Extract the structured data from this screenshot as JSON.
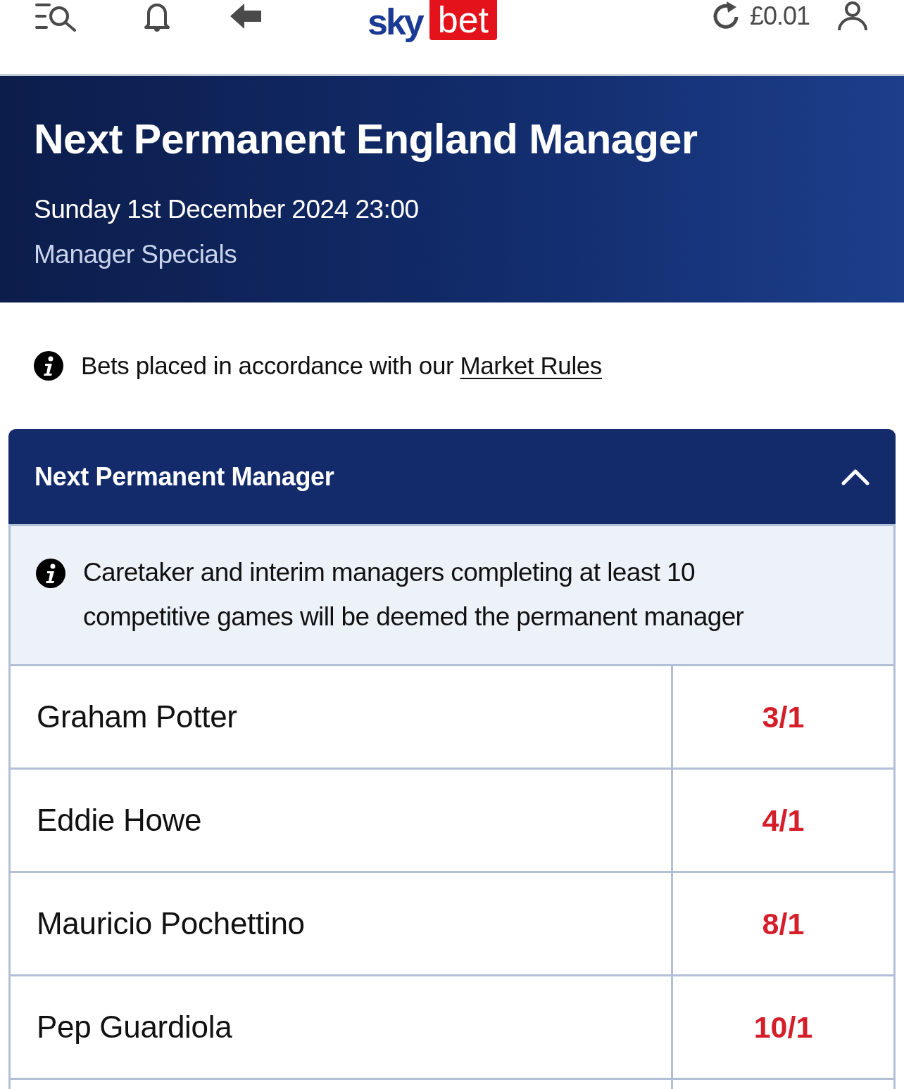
{
  "header": {
    "logo": {
      "word_1": "sky",
      "word_2": "bet"
    },
    "balance": "£0.01"
  },
  "event": {
    "title": "Next Permanent England Manager",
    "date": "Sunday 1st December 2024 23:00",
    "category": "Manager Specials"
  },
  "notice": {
    "text": "Bets placed in accordance with our",
    "link": "Market Rules"
  },
  "market": {
    "title": "Next Permanent Manager",
    "expanded": true,
    "info": "Caretaker and interim managers completing at least 10 competitive games will be deemed the permanent manager",
    "selections": [
      {
        "name": "Graham Potter",
        "odds": "3/1"
      },
      {
        "name": "Eddie Howe",
        "odds": "4/1"
      },
      {
        "name": "Mauricio Pochettino",
        "odds": "8/1"
      },
      {
        "name": "Pep Guardiola",
        "odds": "10/1"
      }
    ]
  }
}
